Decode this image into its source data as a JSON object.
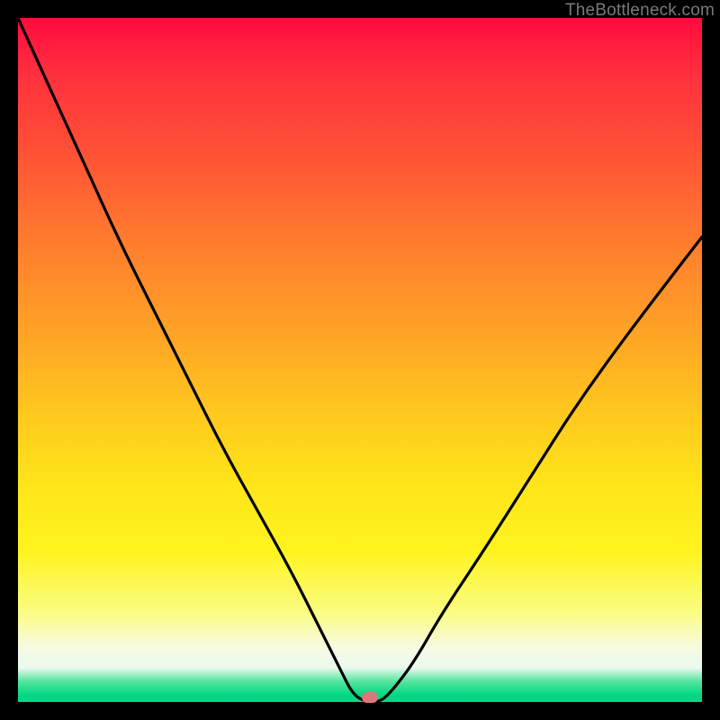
{
  "watermark": "TheBottleneck.com",
  "marker": {
    "x_pct": 51.5,
    "y_pct": 99.3,
    "color": "#d97a7a"
  },
  "chart_data": {
    "type": "line",
    "title": "",
    "xlabel": "",
    "ylabel": "",
    "xlim": [
      0,
      100
    ],
    "ylim": [
      0,
      100
    ],
    "grid": false,
    "legend": false,
    "series": [
      {
        "name": "bottleneck-curve",
        "x": [
          0,
          5,
          10,
          15,
          20,
          25,
          30,
          35,
          40,
          44,
          47,
          49,
          51,
          53,
          55,
          58,
          62,
          68,
          75,
          82,
          90,
          100
        ],
        "values": [
          100,
          89,
          78,
          67,
          57,
          47,
          37,
          28,
          19,
          11,
          5,
          1,
          0,
          0,
          2,
          6,
          13,
          22,
          33,
          44,
          55,
          68
        ]
      }
    ],
    "annotations": [
      {
        "type": "marker",
        "x": 51.5,
        "y": 0.7,
        "shape": "pill",
        "color": "#d97a7a"
      }
    ],
    "background_gradient": {
      "direction": "top-to-bottom",
      "stops": [
        {
          "pct": 0,
          "color": "#ff0b3e"
        },
        {
          "pct": 20,
          "color": "#ff5236"
        },
        {
          "pct": 46,
          "color": "#ffa326"
        },
        {
          "pct": 68,
          "color": "#ffe41a"
        },
        {
          "pct": 92,
          "color": "#f7fbe2"
        },
        {
          "pct": 99,
          "color": "#00d884"
        }
      ]
    }
  }
}
